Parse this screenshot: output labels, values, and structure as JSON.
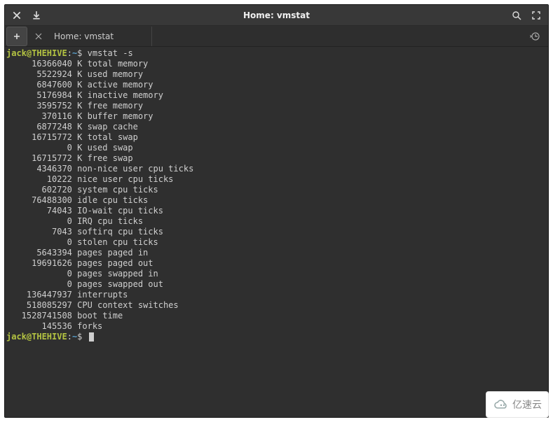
{
  "window": {
    "title": "Home: vmstat"
  },
  "tab": {
    "label": "Home: vmstat"
  },
  "prompt1": {
    "user": "jack@THEHIVE",
    "sep": ":",
    "path": "~",
    "symbol": "$",
    "command": "vmstat -s"
  },
  "output": [
    {
      "value": "16366040",
      "label": "K total memory"
    },
    {
      "value": "5522924",
      "label": "K used memory"
    },
    {
      "value": "6847600",
      "label": "K active memory"
    },
    {
      "value": "5176984",
      "label": "K inactive memory"
    },
    {
      "value": "3595752",
      "label": "K free memory"
    },
    {
      "value": "370116",
      "label": "K buffer memory"
    },
    {
      "value": "6877248",
      "label": "K swap cache"
    },
    {
      "value": "16715772",
      "label": "K total swap"
    },
    {
      "value": "0",
      "label": "K used swap"
    },
    {
      "value": "16715772",
      "label": "K free swap"
    },
    {
      "value": "4346370",
      "label": "non-nice user cpu ticks"
    },
    {
      "value": "10222",
      "label": "nice user cpu ticks"
    },
    {
      "value": "602720",
      "label": "system cpu ticks"
    },
    {
      "value": "76488300",
      "label": "idle cpu ticks"
    },
    {
      "value": "74043",
      "label": "IO-wait cpu ticks"
    },
    {
      "value": "0",
      "label": "IRQ cpu ticks"
    },
    {
      "value": "7043",
      "label": "softirq cpu ticks"
    },
    {
      "value": "0",
      "label": "stolen cpu ticks"
    },
    {
      "value": "5643394",
      "label": "pages paged in"
    },
    {
      "value": "19691626",
      "label": "pages paged out"
    },
    {
      "value": "0",
      "label": "pages swapped in"
    },
    {
      "value": "0",
      "label": "pages swapped out"
    },
    {
      "value": "136447937",
      "label": "interrupts"
    },
    {
      "value": "518085297",
      "label": "CPU context switches"
    },
    {
      "value": "1528741508",
      "label": "boot time"
    },
    {
      "value": "145536",
      "label": "forks"
    }
  ],
  "prompt2": {
    "user": "jack@THEHIVE",
    "sep": ":",
    "path": "~",
    "symbol": "$"
  },
  "watermark": {
    "text": "亿速云"
  }
}
